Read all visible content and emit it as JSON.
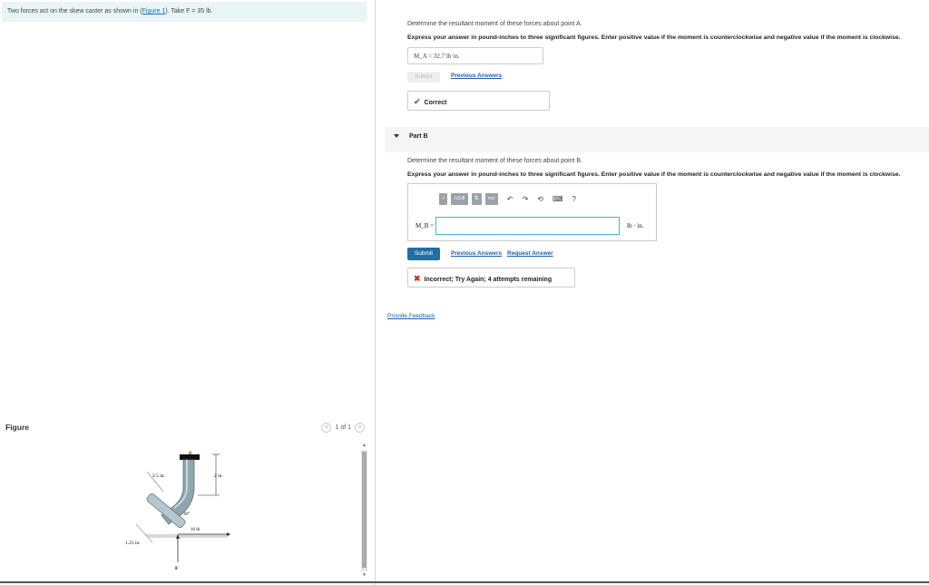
{
  "intro": {
    "text_before": "Two forces act on the skew caster as shown in (",
    "link": "Figure 1",
    "text_after": "). Take F = 35 lb."
  },
  "figure": {
    "title": "Figure",
    "pager": {
      "text": "1 of 1",
      "prev": "<",
      "next": ">"
    },
    "labels": {
      "a": "A",
      "b": "B",
      "dim25": "2.5 in.",
      "dim2": "2 in.",
      "dim125": "1.25 in.",
      "angle": "30°",
      "force10": "10 lb",
      "forceF": "F"
    }
  },
  "partA": {
    "prompt": "Determine the resultant moment of these forces about point A.",
    "hint": "Express your answer in pound-inches to three significant figures. Enter positive value if the moment is counterclockwise and negative value if the moment is clockwise.",
    "answer": "M_A = 32.7 lb·in.",
    "submit": "Submit",
    "previous_answers": "Previous Answers",
    "feedback": "Correct"
  },
  "partB": {
    "heading": "Part B",
    "prompt": "Determine the resultant moment of these forces about point B.",
    "hint": "Express your answer in pound-inches to three significant figures. Enter positive value if the moment is counterclockwise and negative value if the moment is clockwise.",
    "toolbar": [
      "√",
      "ΑΣΦ",
      "⇅",
      "vec"
    ],
    "label": "M_B =",
    "unit": "lb · in.",
    "submit": "Submit",
    "previous_answers": "Previous Answers",
    "request_answer": "Request Answer",
    "feedback": "Incorrect; Try Again; 4 attempts remaining"
  },
  "provide_feedback": "Provide Feedback",
  "colors": {
    "correct": "#3a8f2e",
    "incorrect": "#c0392b",
    "link": "#1a5fa8",
    "submit": "#236ea4"
  }
}
